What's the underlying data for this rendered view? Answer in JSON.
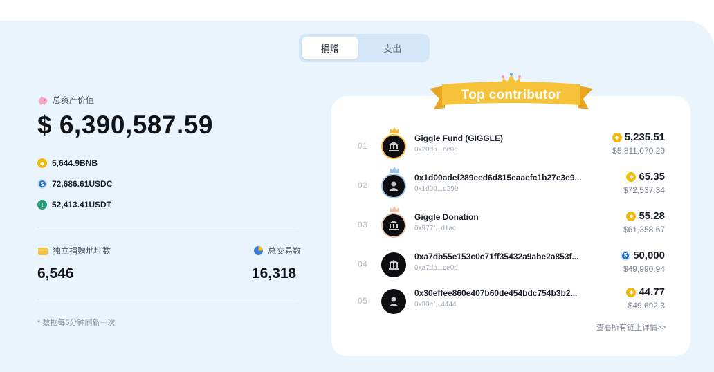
{
  "tabs": [
    {
      "label": "捐赠",
      "active": true
    },
    {
      "label": "支出",
      "active": false
    }
  ],
  "summary": {
    "total_label": "总资产价值",
    "total_value": "$ 6,390,587.59",
    "assets": [
      {
        "icon": "bnb-coin-icon",
        "text": "5,644.9BNB"
      },
      {
        "icon": "usdc-coin-icon",
        "text": "72,686.61USDC"
      },
      {
        "icon": "usdt-coin-icon",
        "text": "52,413.41USDT"
      }
    ],
    "unique_label": "独立捐赠地址数",
    "unique_value": "6,546",
    "tx_label": "总交易数",
    "tx_value": "16,318",
    "note": "* 数据每5分钟刷新一次"
  },
  "leaderboard": {
    "banner": "Top contributor",
    "rows": [
      {
        "rank": "01",
        "name": "Giggle Fund (GIGGLE)",
        "address": "0x20d6...ce0e",
        "amount": "5,235.51",
        "coin": "bnb-coin-icon",
        "usd": "$5,811,070.29",
        "avatar": "bank-icon"
      },
      {
        "rank": "02",
        "name": "0x1d00adef289eed6d815eaaefc1b27e3e9...",
        "address": "0x1d00...d299",
        "amount": "65.35",
        "coin": "bnb-coin-icon",
        "usd": "$72,537.34",
        "avatar": "user-icon"
      },
      {
        "rank": "03",
        "name": "Giggle Donation",
        "address": "0x977f...d1ac",
        "amount": "55.28",
        "coin": "bnb-coin-icon",
        "usd": "$61,358.67",
        "avatar": "bank-icon"
      },
      {
        "rank": "04",
        "name": "0xa7db55e153c0c71ff35432a9abe2a853f...",
        "address": "0xa7db...ce0d",
        "amount": "50,000",
        "coin": "usdc-coin-icon",
        "usd": "$49,990.94",
        "avatar": "bank-icon"
      },
      {
        "rank": "05",
        "name": "0x30effee860e407b60de454bdc754b3b2...",
        "address": "0x30ef...4444",
        "amount": "44.77",
        "coin": "bnb-coin-icon",
        "usd": "$49,692.3",
        "avatar": "user-icon"
      }
    ],
    "details_link": "查看所有链上详情>>"
  },
  "colors": {
    "panel_bg": "#e9f4fd",
    "banner_yellow": "#f6c23a",
    "bnb": "#f0b90b",
    "usdc": "#2775ca",
    "usdt": "#26a17b"
  }
}
